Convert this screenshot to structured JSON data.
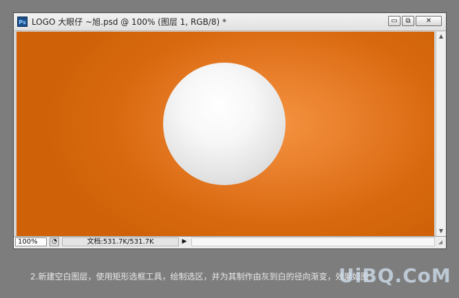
{
  "window": {
    "title": "LOGO 大眼仔 ~旭.psd @ 100% (图层 1, RGB/8) *",
    "app_icon": "Ps",
    "buttons": {
      "minimize": "▭",
      "restore": "⧉",
      "close": "✕"
    }
  },
  "statusbar": {
    "zoom": "100%",
    "doc_info": "文档:531.7K/531.7K",
    "menu_arrow": "▶"
  },
  "caption": "2.新建空白图层，使用矩形选框工具，绘制选区，并为其制作由灰到白的径向渐变，效果如图",
  "watermark": "UiBQ.CoM",
  "colors": {
    "canvas_bg": "#d9690f",
    "canvas_highlight": "#f49240",
    "sphere": "#f7f7f7",
    "page_bg": "#7d7d7d"
  },
  "icons": [
    "photoshop-icon",
    "minimize-icon",
    "restore-icon",
    "close-icon",
    "scroll-up-icon",
    "scroll-down-icon",
    "status-info-icon",
    "resize-grip-icon"
  ]
}
